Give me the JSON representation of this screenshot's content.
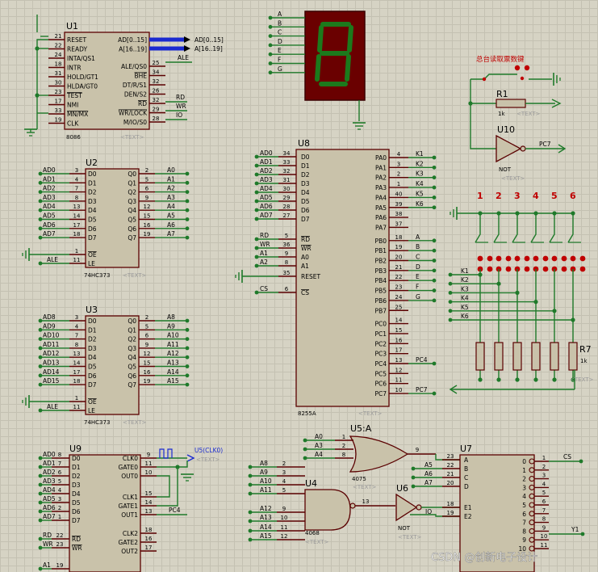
{
  "colors": {
    "wire": "#1f7a2a",
    "body_fill": "#c9c2aa",
    "body_stroke": "#5a0000",
    "pin": "#5a0000",
    "text": "#000000",
    "ref": "#111111",
    "hint": "#9a9a9a",
    "bus": "#1a2ad0",
    "red": "#c00000",
    "gnd": "#1f7a2a"
  },
  "cpu": {
    "ref": "U1",
    "part": "8086",
    "hint": "<TEXT>",
    "left_pins": [
      [
        "21",
        "RESET"
      ],
      [
        "22",
        "READY"
      ],
      [
        "24",
        "INTA/QS1"
      ],
      [
        "18",
        "INTR"
      ],
      [
        "31",
        "HOLD/GT1"
      ],
      [
        "30",
        "HLDA/GT0"
      ],
      [
        "23",
        "TEST"
      ],
      [
        "17",
        "NMI"
      ],
      [
        "33",
        "MN/MX"
      ],
      [
        "19",
        "CLK"
      ]
    ],
    "right_pins": [
      [
        "",
        "AD[0..15]"
      ],
      [
        "",
        "A[16..19]"
      ],
      [
        "25",
        "ALE/QS0"
      ],
      [
        "34",
        "BHE"
      ],
      [
        "32",
        "DT/R/S1"
      ],
      [
        "26",
        "DEN/S2"
      ],
      [
        "32",
        "RD"
      ],
      [
        "29",
        "WR/LOCK"
      ],
      [
        "28",
        "M/IO/S0"
      ]
    ],
    "bus_labels": [
      "AD[0..15]",
      "A[16..19]"
    ],
    "ale_label": "ALE",
    "nets": [
      "RD",
      "WR",
      "IO"
    ]
  },
  "latch_u2": {
    "ref": "U2",
    "part": "74HC373",
    "hint": "<TEXT>",
    "inputs": [
      "AD0",
      "AD1",
      "AD2",
      "AD3",
      "AD4",
      "AD5",
      "AD6",
      "AD7"
    ],
    "in_pins": [
      "3",
      "4",
      "7",
      "8",
      "13",
      "14",
      "17",
      "18"
    ],
    "d": [
      "D0",
      "D1",
      "D2",
      "D3",
      "D4",
      "D5",
      "D6",
      "D7"
    ],
    "q": [
      "Q0",
      "Q1",
      "Q2",
      "Q3",
      "Q4",
      "Q5",
      "Q6",
      "Q7"
    ],
    "out_pins": [
      "2",
      "5",
      "6",
      "9",
      "12",
      "15",
      "16",
      "19"
    ],
    "outputs": [
      "A0",
      "A1",
      "A2",
      "A3",
      "A4",
      "A5",
      "A6",
      "A7"
    ],
    "oe": [
      "1",
      "OE"
    ],
    "le": [
      "11",
      "LE"
    ],
    "le_net": "ALE"
  },
  "latch_u3": {
    "ref": "U3",
    "part": "74HC373",
    "hint": "<TEXT>",
    "inputs": [
      "AD8",
      "AD9",
      "AD10",
      "AD11",
      "AD12",
      "AD13",
      "AD14",
      "AD15"
    ],
    "in_pins": [
      "3",
      "4",
      "7",
      "8",
      "13",
      "14",
      "17",
      "18"
    ],
    "d": [
      "D0",
      "D1",
      "D2",
      "D3",
      "D4",
      "D5",
      "D6",
      "D7"
    ],
    "q": [
      "Q0",
      "Q1",
      "Q2",
      "Q3",
      "Q4",
      "Q5",
      "Q6",
      "Q7"
    ],
    "out_pins": [
      "2",
      "5",
      "6",
      "9",
      "12",
      "15",
      "16",
      "19"
    ],
    "outputs": [
      "A8",
      "A9",
      "A10",
      "A11",
      "A12",
      "A13",
      "A14",
      "A15"
    ],
    "oe": [
      "1",
      "OE"
    ],
    "le": [
      "11",
      "LE"
    ],
    "le_net": "ALE"
  },
  "seg_labels": [
    "A",
    "B",
    "C",
    "D",
    "E",
    "F",
    "G"
  ],
  "ppi": {
    "ref": "U8",
    "part": "8255A",
    "hint": "<TEXT>",
    "left": [
      [
        "AD0",
        "34",
        "D0"
      ],
      [
        "AD1",
        "33",
        "D1"
      ],
      [
        "AD2",
        "32",
        "D2"
      ],
      [
        "AD3",
        "31",
        "D3"
      ],
      [
        "AD4",
        "30",
        "D4"
      ],
      [
        "AD5",
        "29",
        "D5"
      ],
      [
        "AD6",
        "28",
        "D6"
      ],
      [
        "AD7",
        "27",
        "D7"
      ],
      [
        "RD",
        "5",
        "RD"
      ],
      [
        "WR",
        "36",
        "WR"
      ],
      [
        "A1",
        "9",
        "A0"
      ],
      [
        "A2",
        "8",
        "A1"
      ],
      [
        "",
        "35",
        "RESET"
      ],
      [
        "CS",
        "6",
        "CS"
      ]
    ],
    "right": [
      [
        "PA0",
        "4",
        "K1"
      ],
      [
        "PA1",
        "3",
        "K2"
      ],
      [
        "PA2",
        "2",
        "K3"
      ],
      [
        "PA3",
        "1",
        "K4"
      ],
      [
        "PA4",
        "40",
        "K5"
      ],
      [
        "PA5",
        "39",
        "K6"
      ],
      [
        "PA6",
        "38",
        ""
      ],
      [
        "PA7",
        "37",
        ""
      ],
      [
        "PB0",
        "18",
        "A"
      ],
      [
        "PB1",
        "19",
        "B"
      ],
      [
        "PB2",
        "20",
        "C"
      ],
      [
        "PB3",
        "21",
        "D"
      ],
      [
        "PB4",
        "22",
        "E"
      ],
      [
        "PB5",
        "23",
        "F"
      ],
      [
        "PB6",
        "24",
        "G"
      ],
      [
        "PB7",
        "25",
        ""
      ],
      [
        "PC0",
        "14",
        ""
      ],
      [
        "PC1",
        "15",
        ""
      ],
      [
        "PC2",
        "16",
        ""
      ],
      [
        "PC3",
        "17",
        ""
      ],
      [
        "PC4",
        "13",
        "PC4"
      ],
      [
        "PC5",
        "12",
        ""
      ],
      [
        "PC6",
        "11",
        ""
      ],
      [
        "PC7",
        "10",
        "PC7"
      ]
    ]
  },
  "keys": {
    "title": "总台读取票数键",
    "r1_ref": "R1",
    "r1_val": "1k",
    "r1_hint": "<TEXT>",
    "not_ref": "U10",
    "not_part": "NOT",
    "not_hint": "<TEXT>",
    "pc7": "PC7",
    "nums": [
      "1",
      "2",
      "3",
      "4",
      "5",
      "6"
    ],
    "rows": [
      "K1",
      "K2",
      "K3",
      "K4",
      "K5",
      "K6"
    ],
    "r7_ref": "R7",
    "r7_val": "1k",
    "r7_hint": "<TEXT>"
  },
  "timer": {
    "ref": "U9",
    "hint": "<TEXT>",
    "left": [
      [
        "AD0",
        "8",
        "D0"
      ],
      [
        "AD1",
        "7",
        "D1"
      ],
      [
        "AD2",
        "6",
        "D2"
      ],
      [
        "AD3",
        "5",
        "D3"
      ],
      [
        "AD4",
        "4",
        "D4"
      ],
      [
        "AD5",
        "3",
        "D5"
      ],
      [
        "AD6",
        "2",
        "D6"
      ],
      [
        "AD7",
        "1",
        "D7"
      ],
      [
        "RD",
        "22",
        "RD"
      ],
      [
        "WR",
        "23",
        "WR"
      ],
      [
        "A1",
        "19",
        ""
      ]
    ],
    "right": [
      [
        "CLK0",
        "9"
      ],
      [
        "GATE0",
        "11"
      ],
      [
        "OUT0",
        "10"
      ],
      [
        "CLK1",
        "15"
      ],
      [
        "GATE1",
        "14"
      ],
      [
        "OUT1",
        "13"
      ],
      [
        "CLK2",
        "18"
      ],
      [
        "GATE2",
        "16"
      ],
      [
        "OUT2",
        "17"
      ]
    ],
    "pc4": "PC4",
    "clk_label": "U5(CLK0)",
    "clk_hint": "<TEXT>"
  },
  "or_gate": {
    "ref": "U5:A",
    "part": "4075",
    "hint": "<TEXT>",
    "inputs": [
      [
        "A0",
        "1"
      ],
      [
        "A3",
        "2"
      ],
      [
        "A4",
        "8"
      ]
    ],
    "out_pin": "9"
  },
  "nand_gate": {
    "ref": "U4",
    "part": "4068",
    "hint": "<TEXT>",
    "inputs": [
      [
        "A8",
        "2"
      ],
      [
        "A9",
        "3"
      ],
      [
        "A10",
        "4"
      ],
      [
        "A11",
        "5"
      ],
      [
        "A12",
        "9"
      ],
      [
        "A13",
        "10"
      ],
      [
        "A14",
        "11"
      ],
      [
        "A15",
        "12"
      ]
    ],
    "out_pin": "13"
  },
  "not_gate": {
    "ref": "U6",
    "part": "NOT",
    "hint": "<TEXT>",
    "io": "IO"
  },
  "decoder": {
    "ref": "U7",
    "inputs": [
      [
        "",
        "23",
        "A"
      ],
      [
        "A5",
        "22",
        "B"
      ],
      [
        "A6",
        "21",
        "C"
      ],
      [
        "A7",
        "20",
        "D"
      ],
      [
        "",
        "18",
        "E1"
      ],
      [
        "",
        "19",
        "E2"
      ]
    ],
    "out_pins": [
      "1",
      "2",
      "3",
      "4",
      "5",
      "6",
      "7",
      "8",
      "9",
      "10",
      "11"
    ],
    "out_nums": [
      "0",
      "1",
      "2",
      "3",
      "4",
      "5",
      "6",
      "7",
      "8",
      "9",
      "10"
    ],
    "cs": "CS",
    "y1": "Y1"
  },
  "watermark": "CSDN @创新电子设计"
}
